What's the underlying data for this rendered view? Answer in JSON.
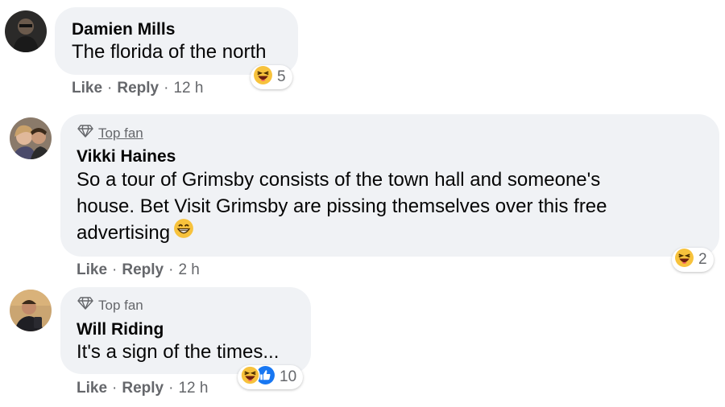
{
  "comments": [
    {
      "author": "Damien Mills",
      "top_fan": false,
      "text": "The florida of the north",
      "like_label": "Like",
      "reply_label": "Reply",
      "time": "12 h",
      "reaction_count": "5",
      "reactions": [
        "haha-icon"
      ]
    },
    {
      "author": "Vikki Haines",
      "top_fan": true,
      "badge_label": "Top fan",
      "text_lines": [
        "So a tour of Grimsby consists of the town hall and someone's",
        "house. Bet Visit Grimsby are pissing themselves over this free",
        "advertising"
      ],
      "inline_emoji": "grinning-smile-emoji-icon",
      "like_label": "Like",
      "reply_label": "Reply",
      "time": "2 h",
      "reaction_count": "2",
      "reactions": [
        "haha-icon"
      ]
    },
    {
      "author": "Will Riding",
      "top_fan": true,
      "badge_label": "Top fan",
      "text": "It's a sign of the times...",
      "like_label": "Like",
      "reply_label": "Reply",
      "time": "12 h",
      "reaction_count": "10",
      "reactions": [
        "haha-icon",
        "like-icon"
      ]
    }
  ],
  "separator": "·",
  "colors": {
    "bubble": "#f0f2f5",
    "secondary_text": "#65676b",
    "primary_text": "#050505",
    "like_blue": "#1877f2",
    "haha_yellow": "#f7c23c"
  }
}
